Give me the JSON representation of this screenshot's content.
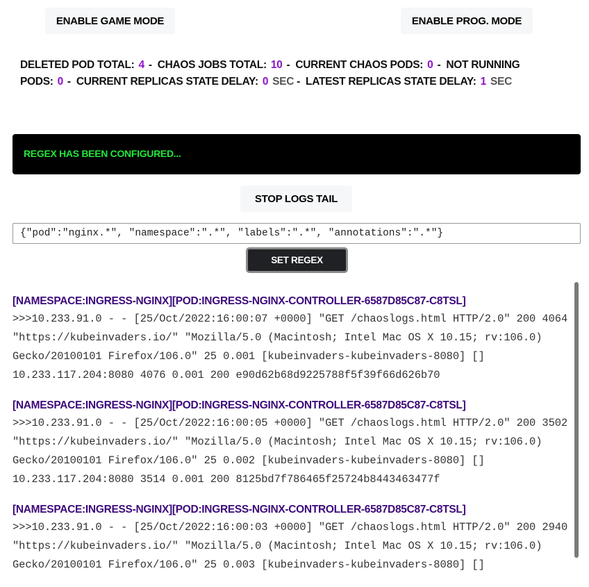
{
  "buttons": {
    "game_mode": "Enable Game Mode",
    "prog_mode": "Enable Prog. Mode",
    "stop_logs": "Stop Logs Tail",
    "set_regex": "Set Regex"
  },
  "stats": {
    "deleted_pod_label": "Deleted Pod Total:",
    "deleted_pod": "4",
    "chaos_jobs_label": "Chaos Jobs Total:",
    "chaos_jobs": "10",
    "current_chaos_label": "Current Chaos Pods:",
    "current_chaos": "0",
    "not_running_label": "Not Running Pods:",
    "not_running": "0",
    "current_delay_label": "Current Replicas State Delay:",
    "current_delay": "0",
    "latest_delay_label": "Latest Replicas State Delay:",
    "latest_delay": "1",
    "unit": "sec",
    "sep": "-"
  },
  "console": {
    "message": "Regex has been configured..."
  },
  "regex": {
    "value": "{\"pod\":\"nginx.*\", \"namespace\":\".*\", \"labels\":\".*\", \"annotations\":\".*\"}"
  },
  "logs": [
    {
      "header": "[namespace:ingress-nginx][pod:ingress-nginx-controller-6587d85c87-c8tsl]",
      "text": ">>>10.233.91.0 - - [25/Oct/2022:16:00:07 +0000] \"GET /chaoslogs.html HTTP/2.0\" 200 4064 \"https://kubeinvaders.io/\" \"Mozilla/5.0 (Macintosh; Intel Mac OS X 10.15; rv:106.0) Gecko/20100101 Firefox/106.0\" 25 0.001 [kubeinvaders-kubeinvaders-8080] [] 10.233.117.204:8080 4076 0.001 200 e90d62b68d9225788f5f39f66d626b70"
    },
    {
      "header": "[namespace:ingress-nginx][pod:ingress-nginx-controller-6587d85c87-c8tsl]",
      "text": ">>>10.233.91.0 - - [25/Oct/2022:16:00:05 +0000] \"GET /chaoslogs.html HTTP/2.0\" 200 3502 \"https://kubeinvaders.io/\" \"Mozilla/5.0 (Macintosh; Intel Mac OS X 10.15; rv:106.0) Gecko/20100101 Firefox/106.0\" 25 0.002 [kubeinvaders-kubeinvaders-8080] [] 10.233.117.204:8080 3514 0.001 200 8125bd7f786465f25724b8443463477f"
    },
    {
      "header": "[namespace:ingress-nginx][pod:ingress-nginx-controller-6587d85c87-c8tsl]",
      "text": ">>>10.233.91.0 - - [25/Oct/2022:16:00:03 +0000] \"GET /chaoslogs.html HTTP/2.0\" 200 2940 \"https://kubeinvaders.io/\" \"Mozilla/5.0 (Macintosh; Intel Mac OS X 10.15; rv:106.0) Gecko/20100101 Firefox/106.0\" 25 0.003 [kubeinvaders-kubeinvaders-8080] []"
    }
  ],
  "colors": {
    "value": "#8a14c4",
    "console_text": "#22e63a",
    "log_header": "#3d0a7a"
  }
}
